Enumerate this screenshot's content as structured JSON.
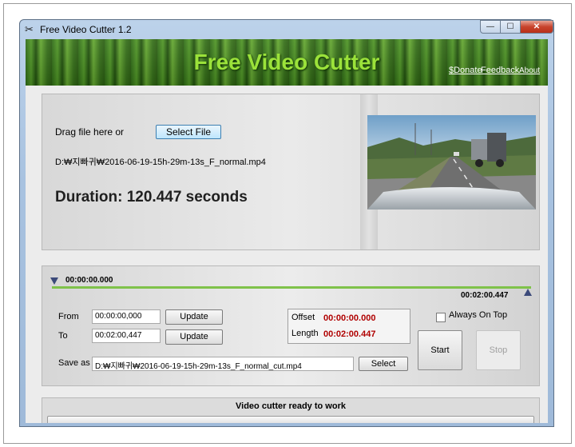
{
  "window": {
    "title": "Free Video Cutter 1.2",
    "controls": {
      "minimize": "—",
      "maximize": "☐",
      "close": "✕"
    }
  },
  "banner": {
    "title": "Free Video Cutter",
    "links": {
      "donate": "$Donate",
      "feedback": "Feedback",
      "about": "About"
    }
  },
  "file_panel": {
    "drag_label": "Drag file here or",
    "select_file_label": "Select File",
    "file_path": "D:₩지빠귀₩2016-06-19-15h-29m-13s_F_normal.mp4",
    "duration": "Duration: 120.447 seconds"
  },
  "timeline": {
    "start_time": "00:00:00.000",
    "end_time": "00:02:00.447"
  },
  "range": {
    "from_label": "From",
    "from_value": "00:00:00,000",
    "to_label": "To",
    "to_value": "00:02:00,447",
    "update_label": "Update"
  },
  "info": {
    "offset_label": "Offset",
    "offset_value": "00:00:00.000",
    "length_label": "Length",
    "length_value": "00:02:00.447"
  },
  "options": {
    "always_on_top_label": "Always On Top",
    "always_on_top_checked": false
  },
  "actions": {
    "start_label": "Start",
    "stop_label": "Stop",
    "stop_enabled": false
  },
  "save": {
    "label": "Save as",
    "path": "D:₩지빠귀₩2016-06-19-15h-29m-13s_F_normal_cut.mp4",
    "select_label": "Select"
  },
  "status": {
    "message": "Video cutter ready to work",
    "progress": 0
  },
  "colors": {
    "banner_title": "#9be23a",
    "timeline_track": "#7fc24a",
    "value_red": "#b00000"
  }
}
